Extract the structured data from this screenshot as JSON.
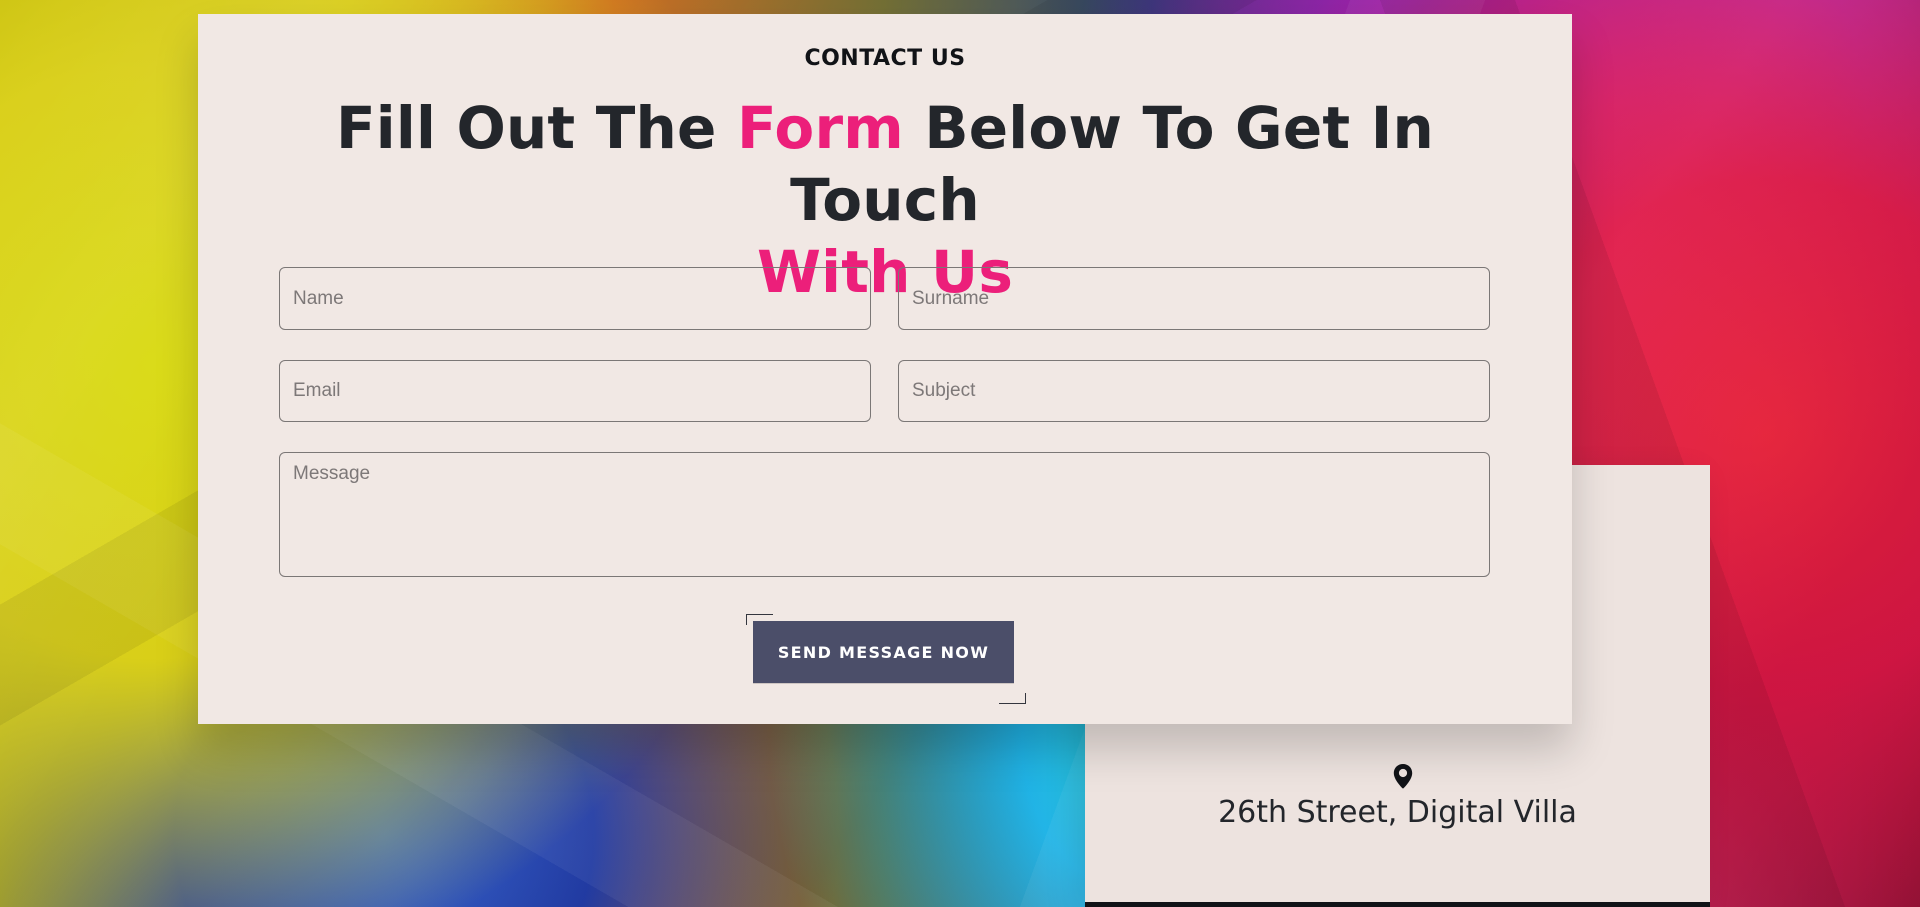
{
  "contact": {
    "eyebrow": "CONTACT US",
    "title_line1_prefix": "Fill Out The ",
    "title_line1_accent": "Form",
    "title_line1_suffix": " Below To Get In Touch",
    "title_line2_accent": "With Us"
  },
  "form": {
    "name_placeholder": "Name",
    "surname_placeholder": "Surname",
    "email_placeholder": "Email",
    "subject_placeholder": "Subject",
    "message_placeholder": "Message",
    "submit_label": "SEND MESSAGE NOW"
  },
  "location": {
    "icon": "location-pin-icon",
    "address": "26th Street, Digital Villa"
  },
  "colors": {
    "panel_background": "#f1e8e4",
    "heading_text": "#23262b",
    "accent": "#ec1f7a",
    "button_background": "#4b4e69"
  }
}
